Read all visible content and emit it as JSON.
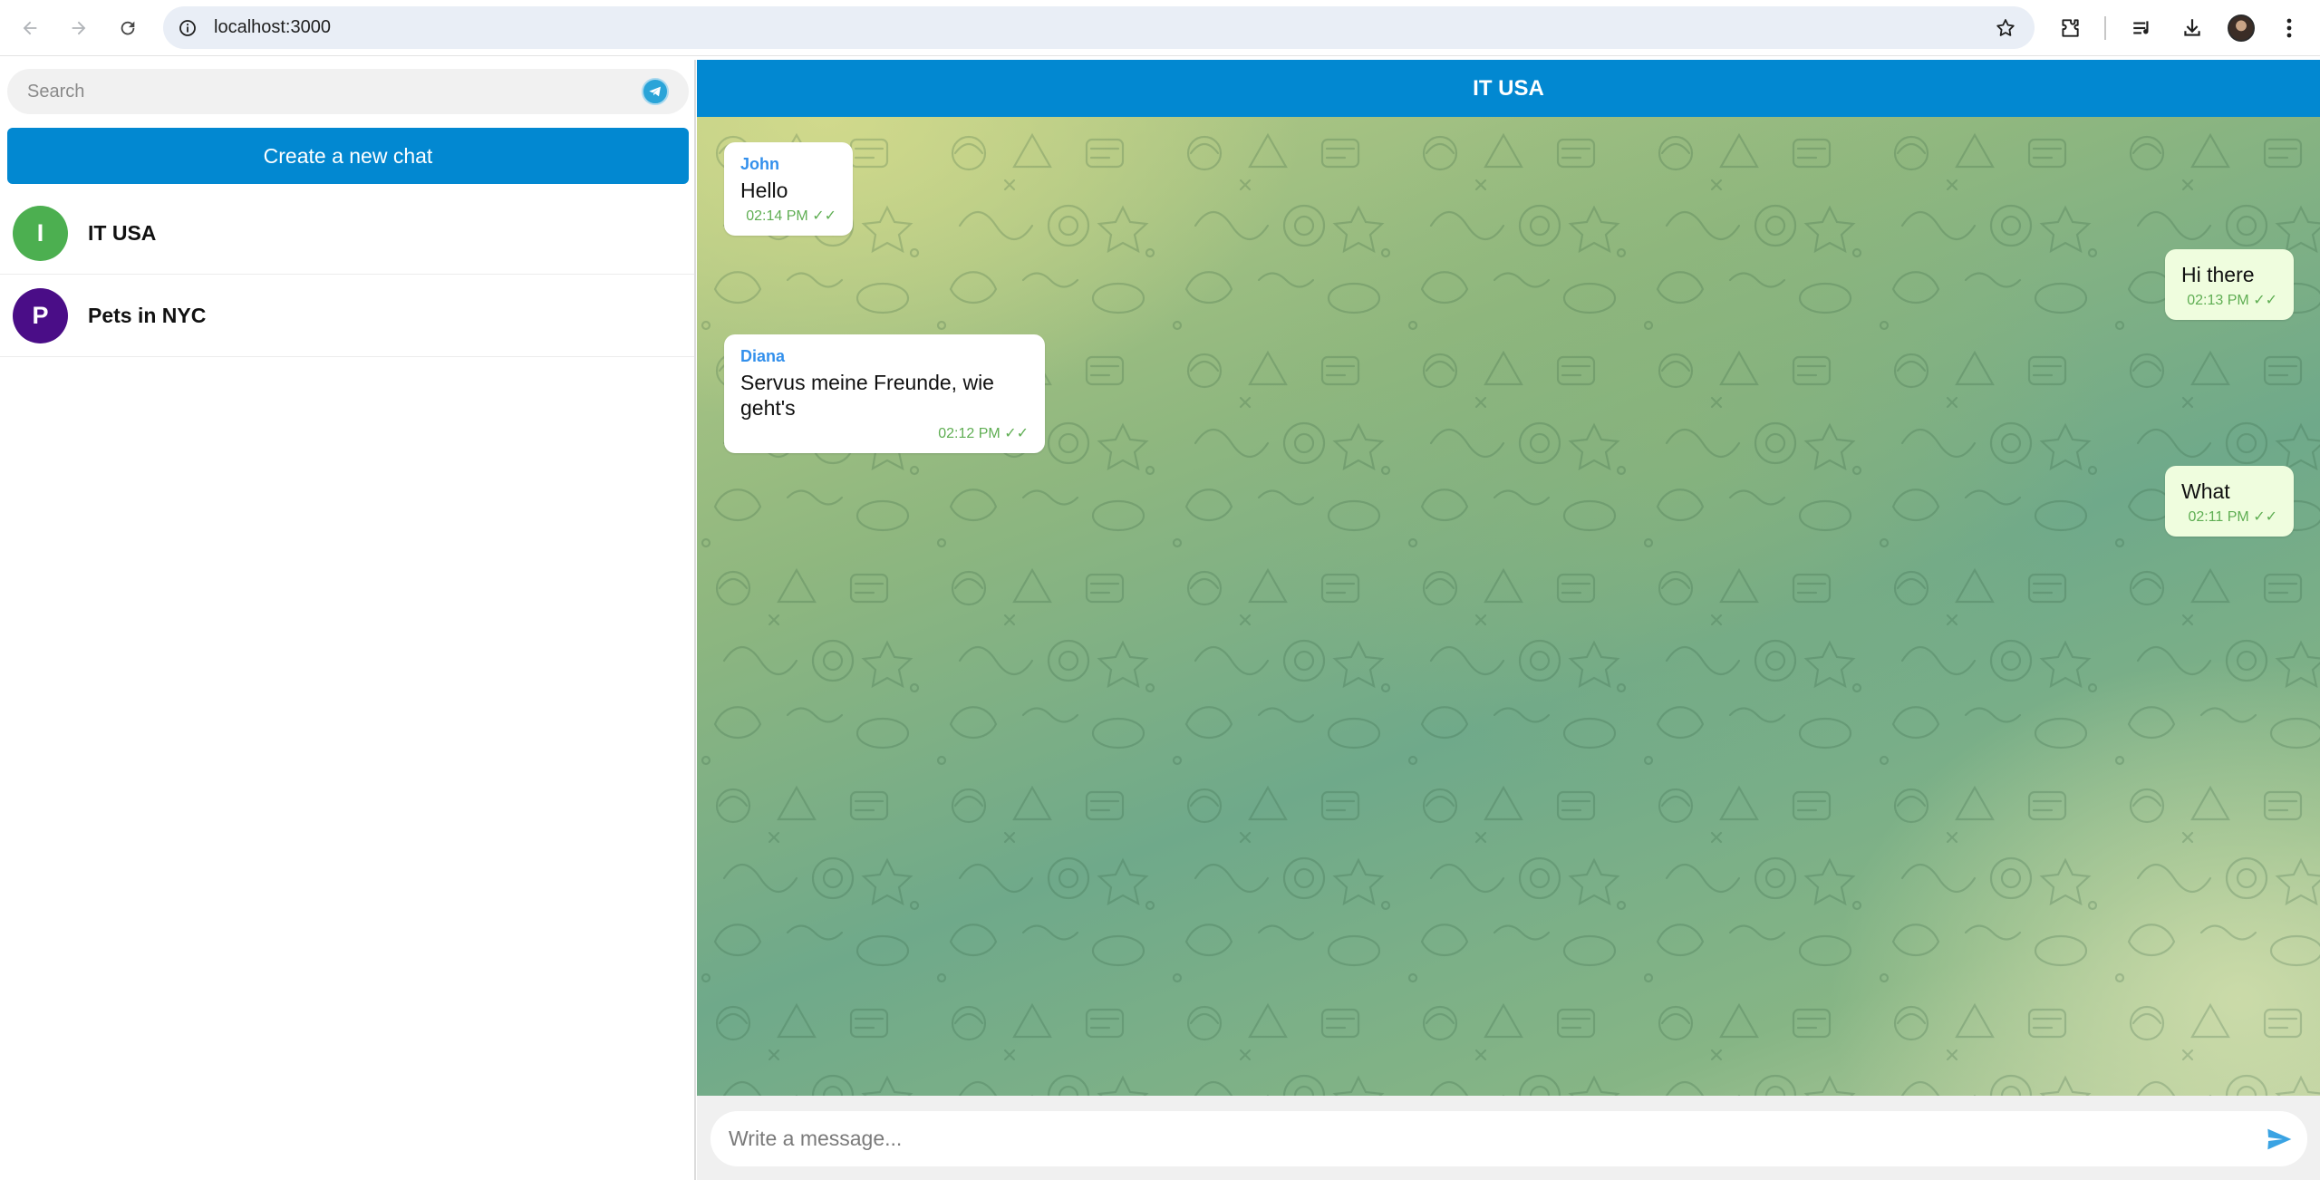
{
  "browser": {
    "url": "localhost:3000",
    "icons": [
      "back-arrow-icon",
      "forward-arrow-icon",
      "reload-icon",
      "site-info-icon",
      "bookmark-star-icon",
      "extensions-icon",
      "reading-list-icon",
      "download-icon",
      "profile-avatar",
      "more-menu-icon"
    ]
  },
  "sidebar": {
    "search_placeholder": "Search",
    "create_button_label": "Create a new chat",
    "chats": [
      {
        "initial": "I",
        "name": "IT USA",
        "avatar_color": "#4caf50"
      },
      {
        "initial": "P",
        "name": "Pets in NYC",
        "avatar_color": "#4a0d87"
      }
    ]
  },
  "chat": {
    "title": "IT USA",
    "messages": [
      {
        "direction": "in",
        "sender": "John",
        "text": "Hello",
        "time": "02:14 PM",
        "status": "✓✓"
      },
      {
        "direction": "out",
        "sender": "",
        "text": "Hi there",
        "time": "02:13 PM",
        "status": "✓✓"
      },
      {
        "direction": "in",
        "sender": "Diana",
        "text": "Servus meine Freunde, wie geht's",
        "time": "02:12 PM",
        "status": "✓✓"
      },
      {
        "direction": "out",
        "sender": "",
        "text": "What",
        "time": "02:11 PM",
        "status": "✓✓"
      }
    ],
    "composer_placeholder": "Write a message..."
  },
  "colors": {
    "accent": "#0288d1",
    "incoming_bubble": "#ffffff",
    "outgoing_bubble": "#effdde",
    "sender_name": "#3390ec",
    "timestamp": "#5fae53"
  }
}
